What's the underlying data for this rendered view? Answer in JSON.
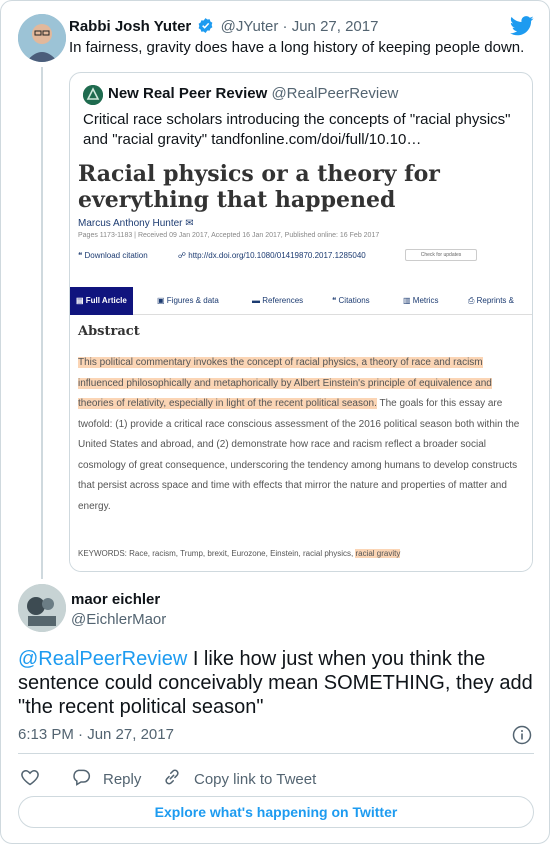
{
  "parent_tweet": {
    "author_name": "Rabbi Josh Yuter",
    "author_handle": "@JYuter",
    "date": "Jun 27, 2017",
    "text": "In fairness, gravity does have a long history of keeping people down."
  },
  "quoted_tweet": {
    "author_name": "New Real Peer Review",
    "author_handle": "@RealPeerReview",
    "text": "Critical race scholars introducing the concepts of \"racial physics\" and \"racial gravity\" tandfonline.com/doi/full/10.10…",
    "article": {
      "title": "Racial physics or a theory for everything that happened",
      "author": "Marcus Anthony Hunter",
      "pages": "Pages 1173-1183 | Received 09 Jan 2017, Accepted 16 Jan 2017, Published online: 16 Feb 2017",
      "download_citation": "Download citation",
      "doi_link": "http://dx.doi.org/10.1080/01419870.2017.1285040",
      "check_updates": "Check for updates",
      "tabs": [
        "Full Article",
        "Figures & data",
        "References",
        "Citations",
        "Metrics",
        "Reprints &"
      ],
      "abstract_heading": "Abstract",
      "abstract_highlighted": "This political commentary invokes the concept of racial physics, a theory of race and racism influenced philosophically and metaphorically by Albert Einstein's principle of equivalence and theories of relativity, especially in light of the recent political season.",
      "abstract_rest": " The goals for this essay are twofold: (1) provide a critical race conscious assessment of the 2016 political season both within the United States and abroad, and (2) demonstrate how race and racism reflect a broader social cosmology of great consequence, underscoring the tendency among humans to develop constructs that persist across space and time with effects that mirror the nature and properties of matter and energy.",
      "keywords_label": "KEYWORDS:",
      "keywords": " Race, racism, Trump, brexit, Eurozone, Einstein, racial physics,",
      "keyword_highlighted": "racial gravity"
    }
  },
  "reply_tweet": {
    "author_name": "maor eichler",
    "author_handle": "@EichlerMaor",
    "mention": "@RealPeerReview",
    "text": " I like how just when you think the sentence could conceivably mean SOMETHING, they add \"the recent political season\"",
    "timestamp": "6:13 PM · Jun 27, 2017"
  },
  "actions": {
    "reply_label": "Reply",
    "copy_link_label": "Copy link to Tweet",
    "explore_label": "Explore what's happening on Twitter"
  },
  "colors": {
    "accent": "#1d9bf0",
    "highlight": "#fbd5b5"
  }
}
